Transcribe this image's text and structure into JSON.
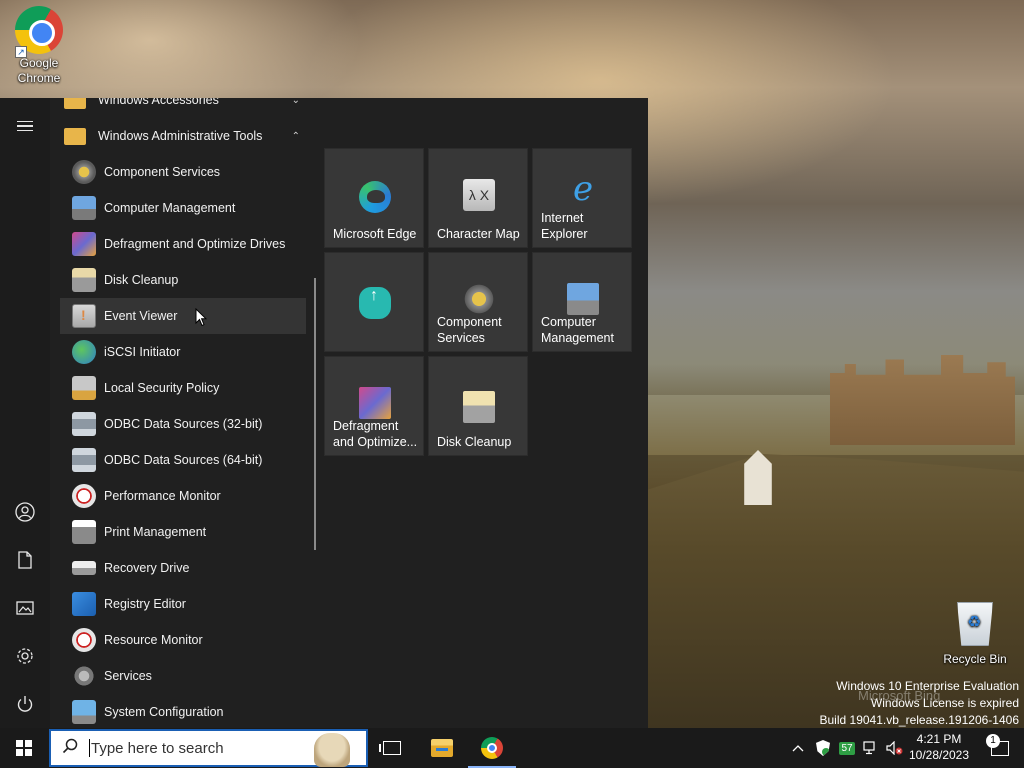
{
  "desktop": {
    "icons": [
      {
        "label_line1": "Google",
        "label_line2": "Chrome",
        "icon": "chrome-icon"
      },
      {
        "label": "Recycle Bin",
        "icon": "recycle-bin-icon"
      }
    ],
    "watermark": {
      "line1": "Windows 10 Enterprise Evaluation",
      "line2": "Windows License is expired",
      "line3": "Build 19041.vb_release.191206-1406"
    },
    "bing_text": "Microsoft Bing"
  },
  "start_menu": {
    "rail": [
      "hamburger-menu-icon",
      "user-icon",
      "documents-icon",
      "pictures-icon",
      "settings-icon",
      "power-icon"
    ],
    "app_list": [
      {
        "label": "Windows Accessories",
        "type": "folder",
        "expanded": false,
        "icon": "folder-icon"
      },
      {
        "label": "Windows Administrative Tools",
        "type": "folder",
        "expanded": true,
        "icon": "folder-icon"
      },
      {
        "label": "Component Services",
        "icon": "component-services-icon"
      },
      {
        "label": "Computer Management",
        "icon": "computer-management-icon"
      },
      {
        "label": "Defragment and Optimize Drives",
        "icon": "defragment-icon"
      },
      {
        "label": "Disk Cleanup",
        "icon": "disk-cleanup-icon"
      },
      {
        "label": "Event Viewer",
        "icon": "event-viewer-icon",
        "hovered": true
      },
      {
        "label": "iSCSI Initiator",
        "icon": "iscsi-initiator-icon"
      },
      {
        "label": "Local Security Policy",
        "icon": "local-security-policy-icon"
      },
      {
        "label": "ODBC Data Sources (32-bit)",
        "icon": "odbc-icon"
      },
      {
        "label": "ODBC Data Sources (64-bit)",
        "icon": "odbc-icon"
      },
      {
        "label": "Performance Monitor",
        "icon": "performance-monitor-icon"
      },
      {
        "label": "Print Management",
        "icon": "print-management-icon"
      },
      {
        "label": "Recovery Drive",
        "icon": "recovery-drive-icon"
      },
      {
        "label": "Registry Editor",
        "icon": "registry-editor-icon"
      },
      {
        "label": "Resource Monitor",
        "icon": "resource-monitor-icon"
      },
      {
        "label": "Services",
        "icon": "services-icon"
      },
      {
        "label": "System Configuration",
        "icon": "system-configuration-icon"
      }
    ],
    "tiles": [
      {
        "label": "Microsoft Edge",
        "icon": "edge-icon"
      },
      {
        "label": "Character Map",
        "icon": "character-map-icon",
        "glyph": "λ X"
      },
      {
        "label_line1": "Internet",
        "label_line2": "Explorer",
        "icon": "internet-explorer-icon",
        "glyph": "e"
      },
      {
        "label": "",
        "icon": "cloud-upload-icon"
      },
      {
        "label_line1": "Component",
        "label_line2": "Services",
        "icon": "component-services-icon"
      },
      {
        "label_line1": "Computer",
        "label_line2": "Management",
        "icon": "computer-management-icon"
      },
      {
        "label_line1": "Defragment",
        "label_line2": "and Optimize...",
        "icon": "defragment-icon"
      },
      {
        "label": "Disk Cleanup",
        "icon": "disk-cleanup-icon"
      }
    ]
  },
  "taskbar": {
    "search_placeholder": "Type here to search",
    "pinned": [
      "task-view-icon",
      "file-explorer-icon",
      "chrome-icon"
    ],
    "tray": {
      "overflow_glyph": "^",
      "badge_value": "57",
      "time": "4:21 PM",
      "date": "10/28/2023",
      "notification_count": "1"
    }
  },
  "colors": {
    "start_bg": "#202020",
    "tile_bg": "#373737",
    "taskbar_bg": "#1a1a1a",
    "accent": "#1a5fb4"
  }
}
